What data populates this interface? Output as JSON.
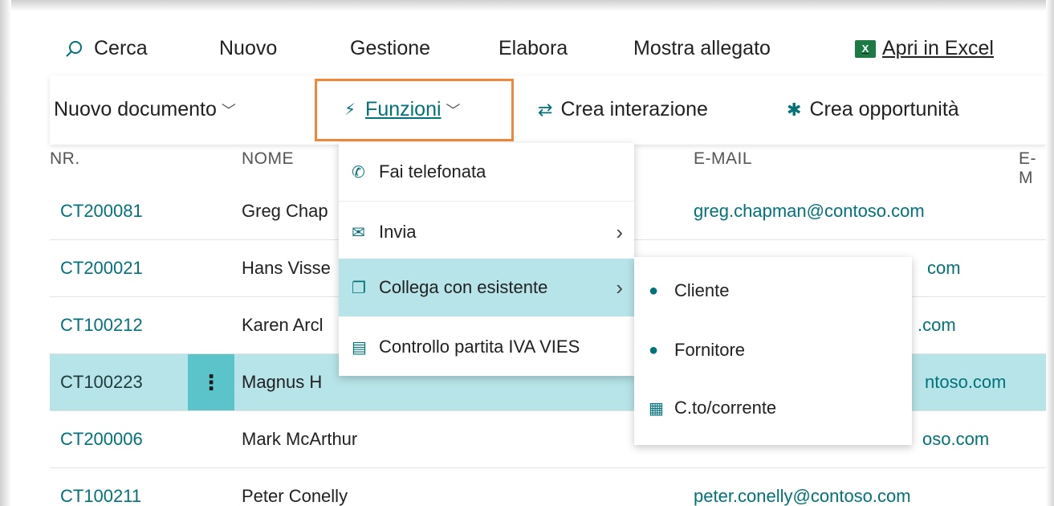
{
  "action_bar": {
    "search": "Cerca",
    "new": "Nuovo",
    "manage": "Gestione",
    "process": "Elabora",
    "show_attachment": "Mostra allegato",
    "open_excel": "Apri in Excel"
  },
  "toolbar": {
    "new_document": "Nuovo documento",
    "functions": "Funzioni",
    "create_interaction": "Crea interazione",
    "create_opportunity": "Crea opportunità"
  },
  "table": {
    "headers": {
      "nr": "NR.",
      "name": "NOME",
      "email": "E-MAIL",
      "email2": "E-M"
    },
    "rows": [
      {
        "nr": "CT200081",
        "name": "Greg Chap",
        "email": "greg.chapman@contoso.com"
      },
      {
        "nr": "CT200021",
        "name": "Hans Visse",
        "email": "com"
      },
      {
        "nr": "CT100212",
        "name": "Karen Arcl",
        "email": ".com"
      },
      {
        "nr": "CT100223",
        "name": "Magnus H",
        "email": "ntoso.com"
      },
      {
        "nr": "CT200006",
        "name": "Mark McArthur",
        "email": "oso.com"
      },
      {
        "nr": "CT100211",
        "name": "Peter Conelly",
        "email": "peter.conelly@contoso.com"
      }
    ],
    "selected_row": 3
  },
  "functions_menu": {
    "items": [
      {
        "label": "Fai telefonata",
        "icon": "phone-icon"
      },
      {
        "label": "Invia",
        "icon": "send-icon",
        "submenu": true
      },
      {
        "label": "Collega con esistente",
        "icon": "link-document-icon",
        "submenu": true
      },
      {
        "label": "Controllo partita IVA VIES",
        "icon": "vat-check-icon"
      }
    ]
  },
  "link_submenu": {
    "items": [
      {
        "label": "Cliente",
        "icon": "person-icon"
      },
      {
        "label": "Fornitore",
        "icon": "person-icon"
      },
      {
        "label": "C.to/corrente",
        "icon": "bank-account-icon"
      }
    ]
  },
  "colors": {
    "accent": "#00727a",
    "highlight_box": "#f0883a",
    "selected_row": "#b7e4e8",
    "row_menu": "#5bc4cb"
  }
}
